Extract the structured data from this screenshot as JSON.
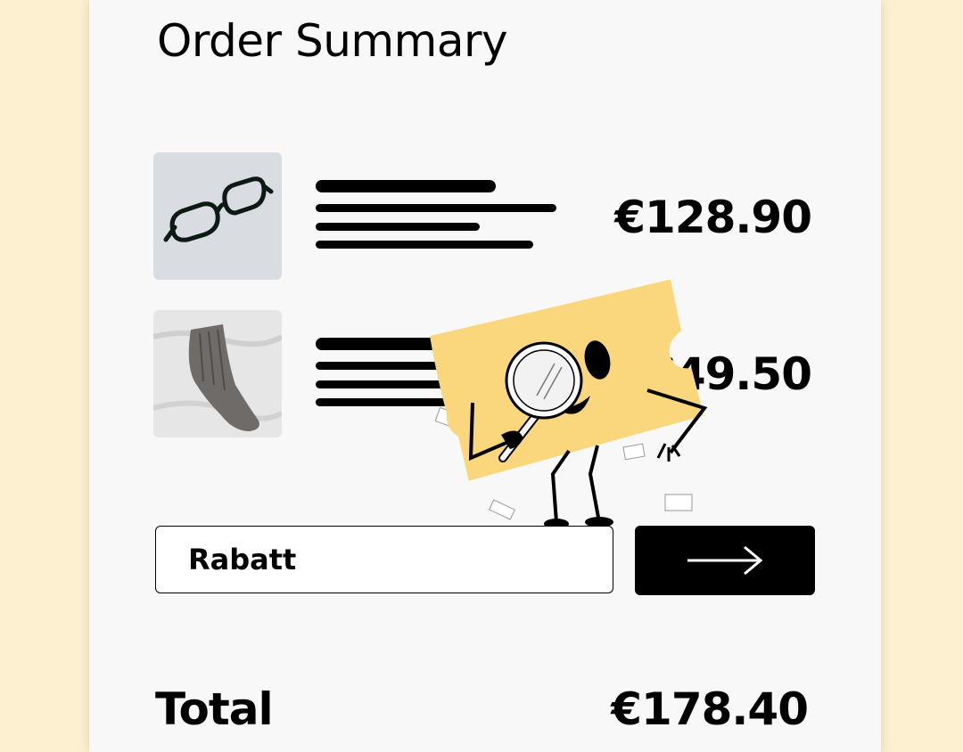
{
  "header": {
    "title": "Order Summary"
  },
  "items": [
    {
      "name": "eyeglasses",
      "image": "glasses-photo",
      "price": "€128.90"
    },
    {
      "name": "knitted sock",
      "image": "sock-photo",
      "price": "€49.50"
    }
  ],
  "coupon": {
    "value": "Rabatt",
    "submit_icon": "arrow-right-icon"
  },
  "summary": {
    "total_label": "Total",
    "total_value": "€178.40"
  },
  "colors": {
    "background": "#fcf0d0",
    "card": "#f8f8f8",
    "ticket": "#fad77d",
    "button": "#000000"
  }
}
